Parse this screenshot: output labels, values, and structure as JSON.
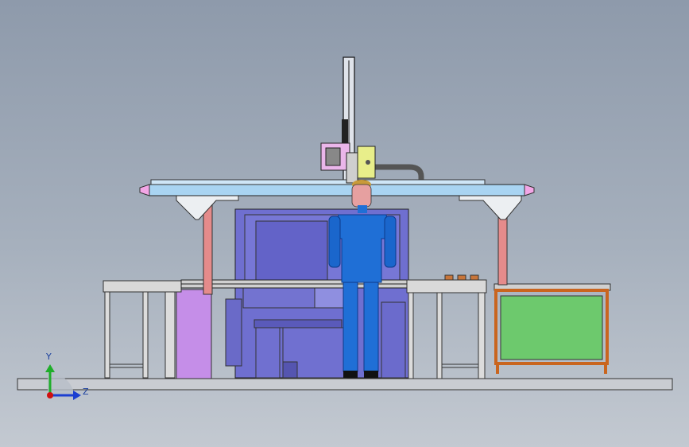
{
  "viewport": {
    "background_top": "#8e9aab",
    "background_bottom": "#c3c9d1"
  },
  "axis_triad": {
    "y_label": "Y",
    "z_label": "Z",
    "y_color": "#1fae2a",
    "z_color": "#1c3fd1",
    "origin_color": "#d01010"
  },
  "colors": {
    "gantry_beam": "#a9d4f2",
    "gantry_legs": "#e58b8b",
    "beam_caps": "#f3a6e6",
    "machine_body": "#6f6fd0",
    "purple_panel": "#c58ee8",
    "operator_suit": "#1f6fd6",
    "operator_head": "#e6a0a0",
    "operator_hat": "#c89a3a",
    "green_panel": "#6dc96d",
    "orange_frame": "#c9651f",
    "robot_pink": "#eab6ea",
    "robot_yellow": "#e8ee8a",
    "tables": "#d9d9d9",
    "base_plate": "#c9ccd2"
  }
}
